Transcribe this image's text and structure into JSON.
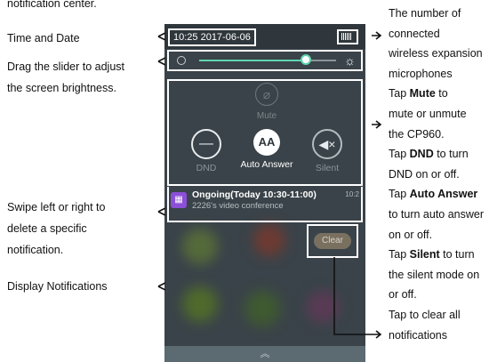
{
  "left_labels": {
    "top_partial": "notification center.",
    "time_date": "Time and Date",
    "slider_line1": "Drag the slider to adjust",
    "slider_line2": "the screen brightness.",
    "swipe_line1": "Swipe left or right to",
    "swipe_line2": "delete a specific",
    "swipe_line3": "notification.",
    "display_notifications": "Display Notifications"
  },
  "right_labels": {
    "l1": "The number of",
    "l2": "connected",
    "l3": "wireless expansion",
    "l4": "microphones",
    "mute_pre": "Tap ",
    "mute_bold": "Mute",
    "mute_post": " to",
    "l6": "mute or unmute",
    "l7": "the CP960.",
    "dnd_pre": "Tap ",
    "dnd_bold": "DND",
    "dnd_post": " to turn",
    "l9": "DND on or off.",
    "auto_pre": "Tap ",
    "auto_bold": "Auto Answer",
    "l11": "to turn auto answer",
    "l12": "on or off.",
    "silent_pre": "Tap ",
    "silent_bold": "Silent",
    "silent_post": " to turn",
    "l14": "the silent mode on",
    "l15": "or off.",
    "l16": "Tap to clear all",
    "l17": "notifications"
  },
  "phone": {
    "datetime": "10:25 2017-06-06",
    "brightness_level": 0.78,
    "mute_label": "Mute",
    "dnd_label": "DND",
    "auto_answer_label": "Auto Answer",
    "auto_answer_glyph": "AA",
    "silent_label": "Silent",
    "notification_title": "Ongoing(Today 10:30-11:00)",
    "notification_subtitle": "2226's video conference",
    "notification_time": "10:2",
    "clear_label": "Clear",
    "accent_color": "#5fd6b0",
    "notification_icon_color": "#8c4fd8"
  }
}
